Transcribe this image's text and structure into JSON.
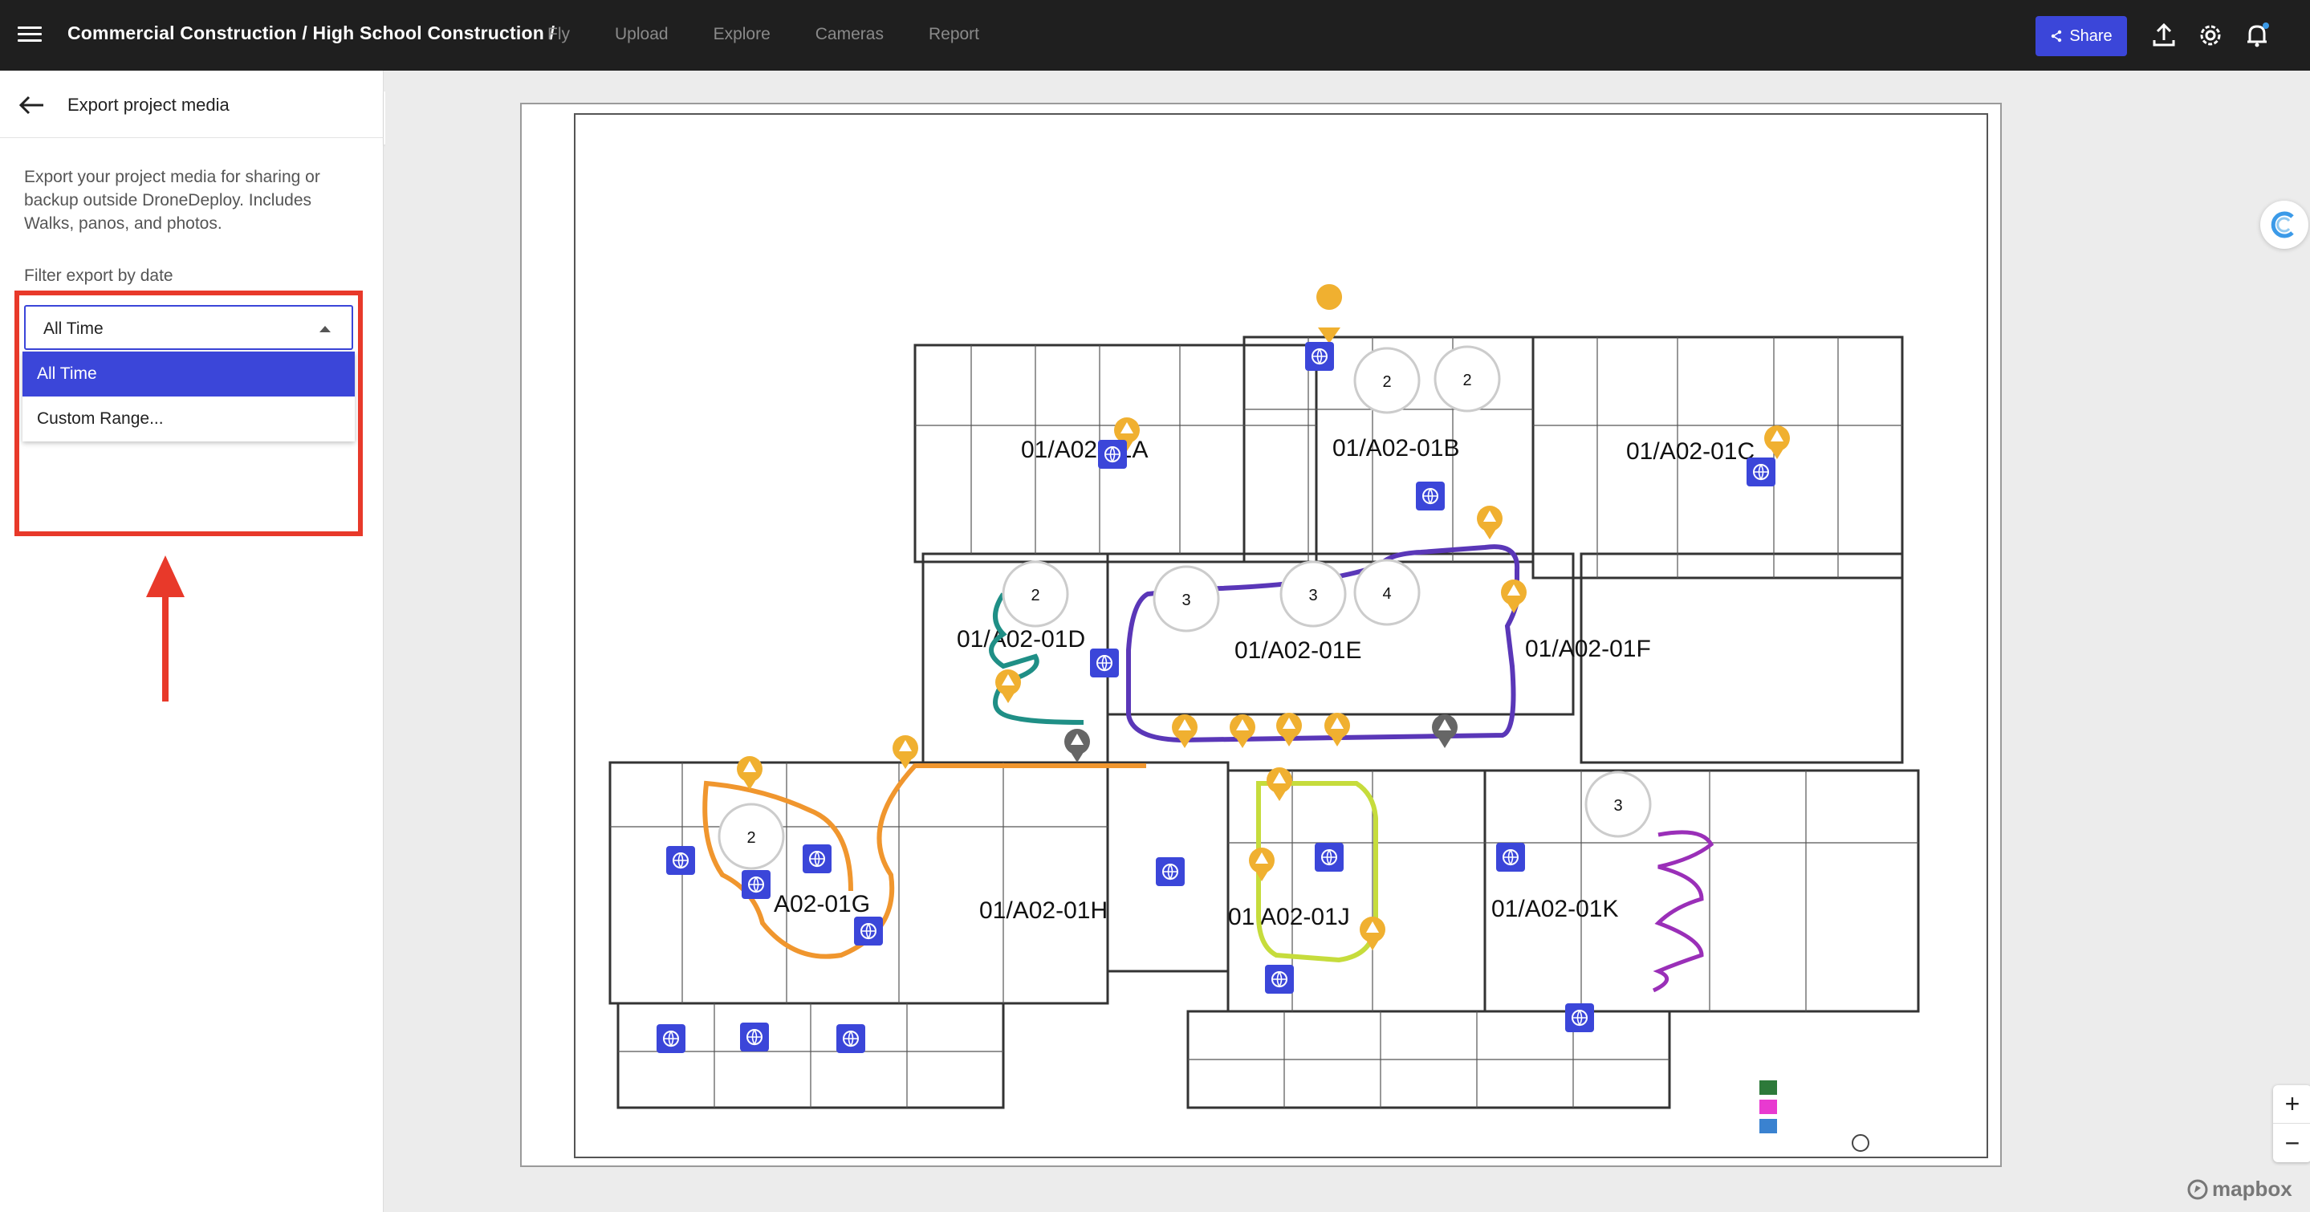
{
  "topbar": {
    "breadcrumb": "Commercial Construction / High School Construction /",
    "tabs": [
      "Fly",
      "Upload",
      "Explore",
      "Cameras",
      "Report"
    ],
    "share_label": "Share"
  },
  "panel": {
    "title": "Export project media",
    "description": "Export your project media for sharing or backup outside DroneDeploy. Includes Walks, panos, and photos.",
    "filter_label": "Filter export by date",
    "select_value": "All Time",
    "options": [
      "All Time",
      "Custom Range..."
    ]
  },
  "map": {
    "areas": [
      "01/A02-01A",
      "01/A02-01B",
      "01/A02-01C",
      "01/A02-01D",
      "01/A02-01E",
      "01/A02-01F",
      "A02-01G",
      "01/A02-01H",
      "01 A02-01J",
      "01/A02-01K"
    ],
    "cluster_counts": [
      "2",
      "2",
      "2",
      "3",
      "3",
      "4",
      "2",
      "3"
    ],
    "attribution": "mapbox",
    "zoom_in": "+",
    "zoom_out": "−"
  },
  "colors": {
    "accent": "#3b46d9",
    "highlight": "#e8392a",
    "warning_pin": "#f0b030",
    "pano_pin": "#3b46d9"
  }
}
